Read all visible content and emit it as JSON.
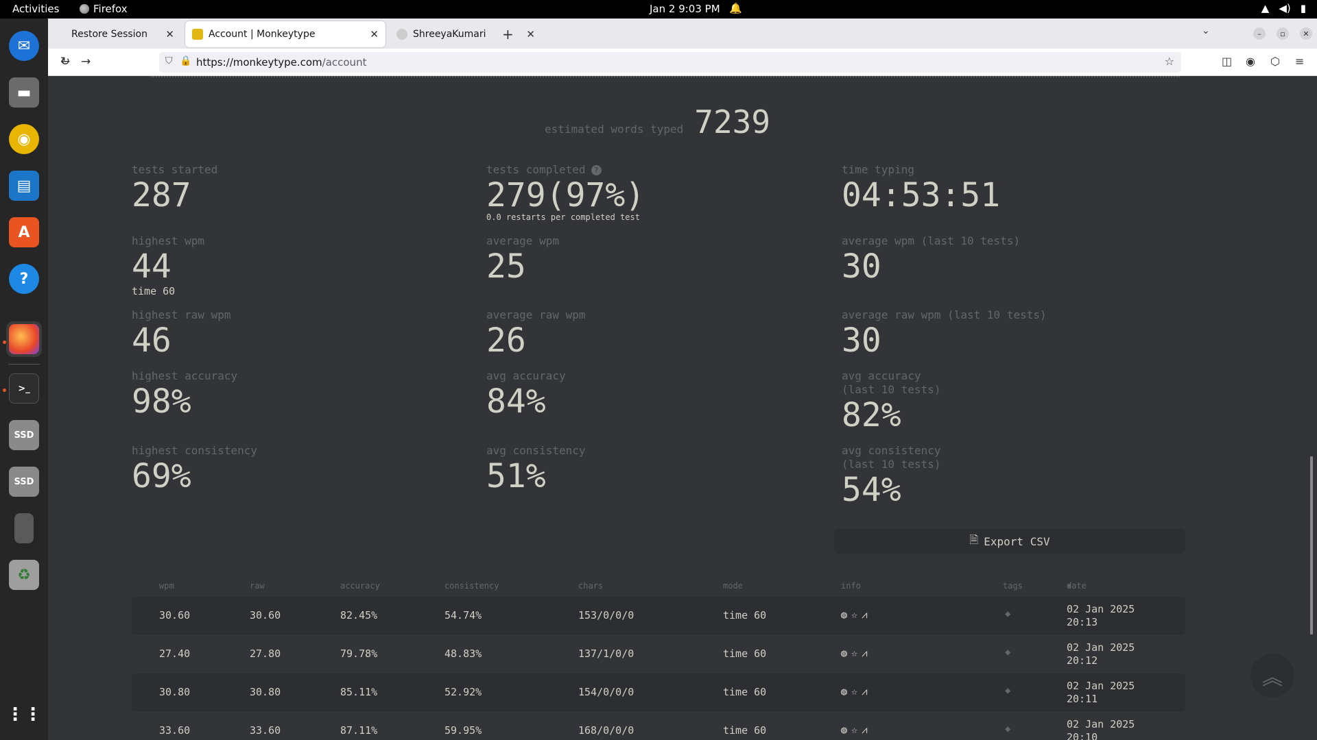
{
  "topbar": {
    "activities": "Activities",
    "app_name": "Firefox",
    "clock": "Jan 2  9:03 PM"
  },
  "browser": {
    "tabs": [
      {
        "label": "Restore Session"
      },
      {
        "label": "Account | Monkeytype"
      },
      {
        "label": "ShreeyaKumari"
      }
    ],
    "url_host": "https://monkeytype.com",
    "url_path": "/account"
  },
  "page": {
    "estimated_label": "estimated words typed",
    "estimated_value": "7239",
    "stats": {
      "tests_started": {
        "label": "tests started",
        "value": "287"
      },
      "tests_completed": {
        "label": "tests completed",
        "value": "279(97%)",
        "note": "0.0 restarts per completed test"
      },
      "time_typing": {
        "label": "time typing",
        "value": "04:53:51"
      },
      "highest_wpm": {
        "label": "highest wpm",
        "value": "44",
        "note": "time 60"
      },
      "average_wpm": {
        "label": "average wpm",
        "value": "25"
      },
      "average_wpm_last10": {
        "label": "average wpm (last 10 tests)",
        "value": "30"
      },
      "highest_raw_wpm": {
        "label": "highest raw wpm",
        "value": "46"
      },
      "average_raw_wpm": {
        "label": "average raw wpm",
        "value": "26"
      },
      "average_raw_wpm_last10": {
        "label": "average raw wpm (last 10 tests)",
        "value": "30"
      },
      "highest_accuracy": {
        "label": "highest accuracy",
        "value": "98%"
      },
      "avg_accuracy": {
        "label": "avg accuracy",
        "value": "84%"
      },
      "avg_accuracy_last10": {
        "label": "avg accuracy\n(last 10 tests)",
        "value": "82%"
      },
      "highest_consistency": {
        "label": "highest consistency",
        "value": "69%"
      },
      "avg_consistency": {
        "label": "avg consistency",
        "value": "51%"
      },
      "avg_consistency_last10": {
        "label": "avg consistency\n(last 10 tests)",
        "value": "54%"
      }
    },
    "export_label": "Export CSV",
    "table": {
      "headers": {
        "wpm": "wpm",
        "raw": "raw",
        "accuracy": "accuracy",
        "consistency": "consistency",
        "chars": "chars",
        "mode": "mode",
        "info": "info",
        "tags": "tags",
        "date": "date"
      },
      "rows": [
        {
          "wpm": "30.60",
          "raw": "30.60",
          "accuracy": "82.45%",
          "consistency": "54.74%",
          "chars": "153/0/0/0",
          "mode": "time 60",
          "date1": "02 Jan 2025",
          "date2": "20:13"
        },
        {
          "wpm": "27.40",
          "raw": "27.80",
          "accuracy": "79.78%",
          "consistency": "48.83%",
          "chars": "137/1/0/0",
          "mode": "time 60",
          "date1": "02 Jan 2025",
          "date2": "20:12"
        },
        {
          "wpm": "30.80",
          "raw": "30.80",
          "accuracy": "85.11%",
          "consistency": "52.92%",
          "chars": "154/0/0/0",
          "mode": "time 60",
          "date1": "02 Jan 2025",
          "date2": "20:11"
        },
        {
          "wpm": "33.60",
          "raw": "33.60",
          "accuracy": "87.11%",
          "consistency": "59.95%",
          "chars": "168/0/0/0",
          "mode": "time 60",
          "date1": "02 Jan 2025",
          "date2": "20:10"
        }
      ]
    }
  },
  "colors": {
    "background": "#323437",
    "text": "#d1d0c5",
    "sub": "#646669",
    "row_alt": "#2c2e31"
  }
}
